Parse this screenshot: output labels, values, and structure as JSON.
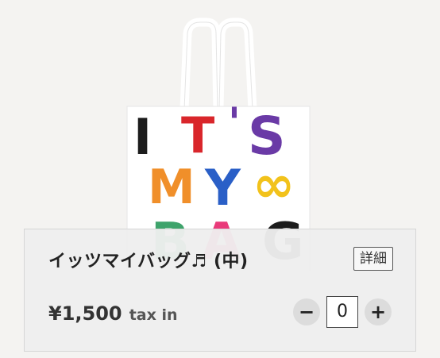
{
  "product": {
    "image_alt": "IT'S MY BAG tote bag",
    "bag_letters": [
      "I",
      "T",
      "'",
      "S",
      "M",
      "Y",
      "∞",
      "B",
      "A",
      "G"
    ],
    "name": "イッツマイバッグ♬ (中)",
    "detail_label": "詳細",
    "price": "¥1,500",
    "tax_label": "tax in",
    "quantity": "0",
    "decrement_label": "−",
    "increment_label": "+"
  },
  "colors": {
    "black": "#1c1c1c",
    "red": "#d9262b",
    "purple": "#6a3aa6",
    "yellow": "#f2c21b",
    "orange": "#f08f2a",
    "blue": "#2a5fc7",
    "green": "#3ea36b",
    "pink": "#e93a7a"
  }
}
